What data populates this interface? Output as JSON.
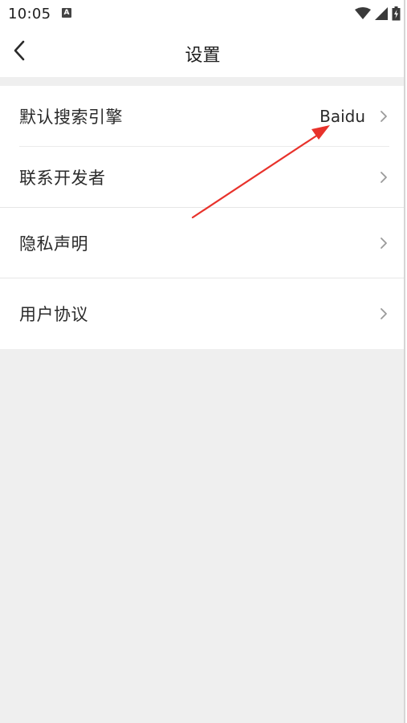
{
  "status_bar": {
    "time": "10:05",
    "notification_icon": "A",
    "icons": [
      "wifi-icon",
      "signal-icon",
      "battery-charging-icon"
    ]
  },
  "header": {
    "title": "设置",
    "back_icon": "chevron-left-icon"
  },
  "settings": {
    "items": [
      {
        "label": "默认搜索引擎",
        "value": "Baidu",
        "icon": "chevron-right-icon"
      },
      {
        "label": "联系开发者",
        "icon": "chevron-right-icon"
      },
      {
        "label": "隐私声明",
        "icon": "chevron-right-icon"
      },
      {
        "label": "用户协议",
        "icon": "chevron-right-icon"
      }
    ]
  },
  "colors": {
    "annotation_arrow": "#e8322b",
    "page_background": "#efefef",
    "surface": "#ffffff",
    "text": "#2a2a2a",
    "chevron": "#9a9a9a"
  }
}
